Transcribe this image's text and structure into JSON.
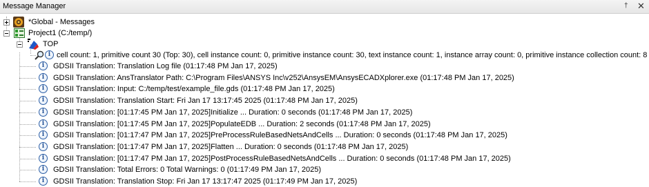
{
  "window": {
    "title": "Message Manager",
    "pin_glyph": "†",
    "close_glyph": "✕"
  },
  "tree": {
    "global": {
      "label": "*Global - Messages",
      "icon": "global-messages-icon"
    },
    "project": {
      "label": "Project1 (C:/temp/)",
      "icon": "project-icon"
    },
    "top": {
      "label": "TOP",
      "icon": "design-icon"
    },
    "cell_summary": "cell count: 1, primitive count 30 (Top: 30), cell instance count: 0, primitive instance count: 30, text instance count: 1, instance array count: 0, primitive instance collection count: 8",
    "messages": [
      "GDSII Translation: Translation Log file (01:17:48 PM  Jan 17, 2025)",
      "GDSII Translation: AnsTranslator Path: C:\\Program Files\\ANSYS Inc\\v252\\AnsysEM\\AnsysECADXplorer.exe (01:17:48 PM  Jan 17, 2025)",
      "GDSII Translation: Input: C:/temp/test/example_file.gds (01:17:48 PM  Jan 17, 2025)",
      "GDSII Translation: Translation Start: Fri Jan 17 13:17:45 2025 (01:17:48 PM  Jan 17, 2025)",
      "GDSII Translation: [01:17:45 PM  Jan 17, 2025]Initialize ... Duration: 0 seconds (01:17:48 PM  Jan 17, 2025)",
      "GDSII Translation: [01:17:45 PM  Jan 17, 2025]PopulateEDB ... Duration: 2 seconds (01:17:48 PM  Jan 17, 2025)",
      "GDSII Translation: [01:17:47 PM  Jan 17, 2025]PreProcessRuleBasedNetsAndCells ... Duration: 0 seconds (01:17:48 PM  Jan 17, 2025)",
      "GDSII Translation: [01:17:47 PM  Jan 17, 2025]Flatten ... Duration: 0 seconds (01:17:48 PM  Jan 17, 2025)",
      "GDSII Translation: [01:17:47 PM  Jan 17, 2025]PostProcessRuleBasedNetsAndCells ... Duration: 0 seconds (01:17:48 PM  Jan 17, 2025)",
      "GDSII Translation: Total Errors: 0 Total Warnings: 0 (01:17:49 PM  Jan 17, 2025)",
      "GDSII Translation: Translation Stop: Fri Jan 17 13:17:47 2025 (01:17:49 PM  Jan 17, 2025)"
    ]
  }
}
